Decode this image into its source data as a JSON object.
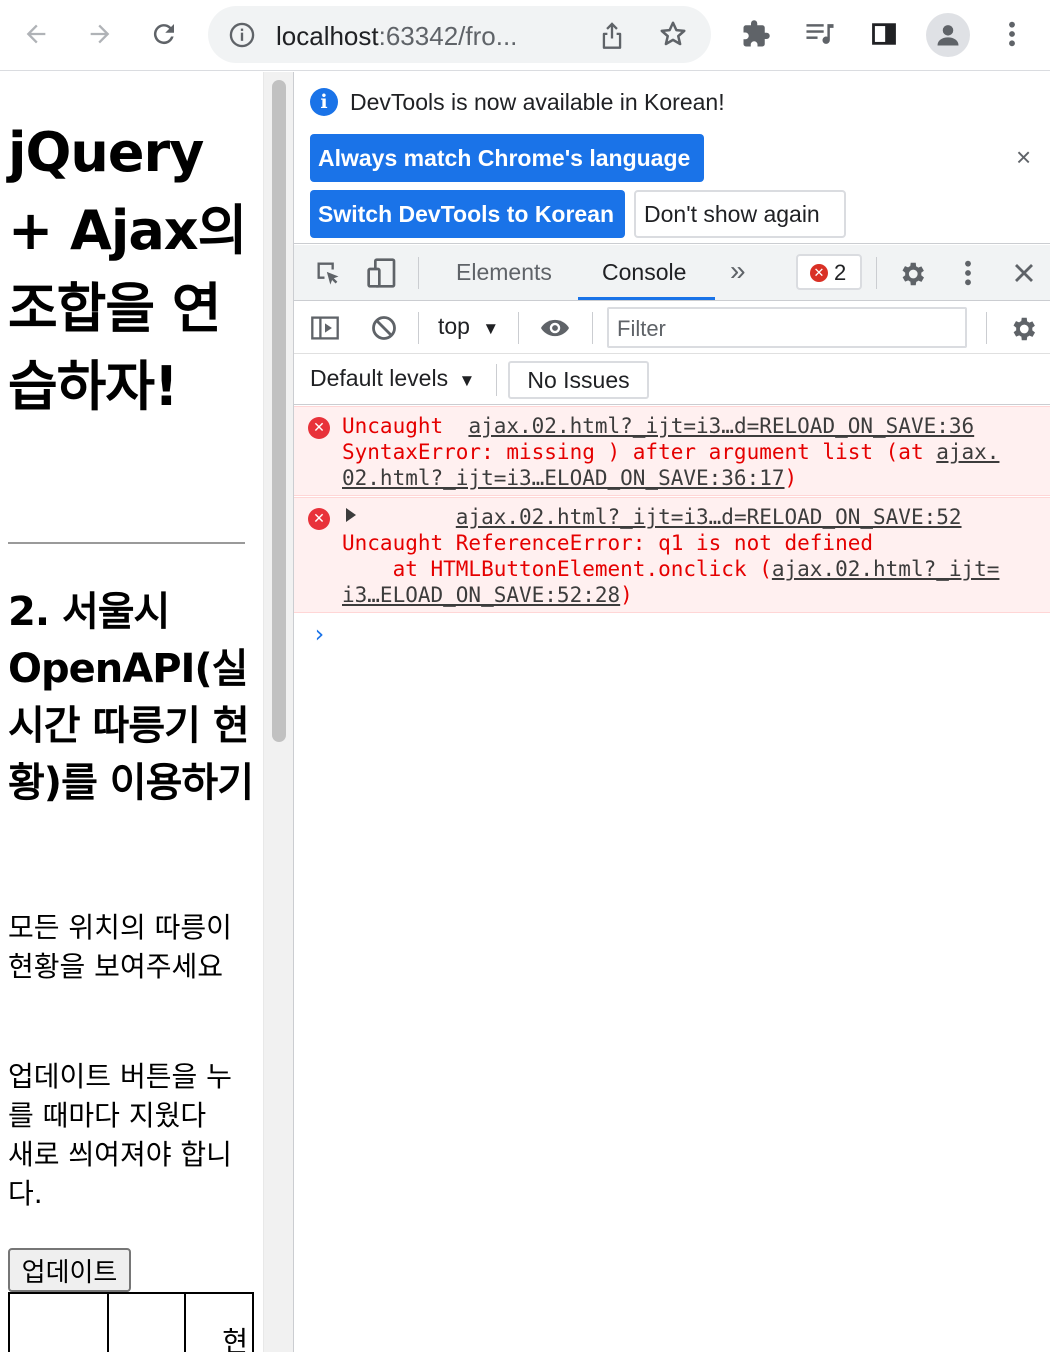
{
  "browser": {
    "url_host": "localhost",
    "url_rest": ":63342/fro..."
  },
  "page": {
    "title": "jQuery + Ajax의 조합을 연습하자!",
    "subtitle": "2. 서울시 OpenAPI(실시간 따릉기 현황)를 이용하기",
    "para1": "모든 위치의 따릉이 현황을 보여주세요",
    "para2": "업데이트 버튼을 누를 때마다 지웠다 새로 씌여져야 합니다.",
    "update_button": "업데이트",
    "table_partial_header": "현"
  },
  "devtools": {
    "infobar": {
      "message": "DevTools is now available in Korean!",
      "match_button": "Always match Chrome's language",
      "switch_button": "Switch DevTools to Korean",
      "dont_show_button": "Don't show again",
      "close": "×"
    },
    "tabs": {
      "elements": "Elements",
      "console": "Console",
      "more": "»"
    },
    "error_count": "2",
    "console_toolbar": {
      "context": "top",
      "filter_placeholder": "Filter",
      "levels": "Default levels",
      "issues": "No Issues"
    },
    "messages": [
      {
        "prefix": "Uncaught  ",
        "link": "ajax.02.html?_ijt=i3…d=RELOAD_ON_SAVE:36",
        "text": "\nSyntaxError: missing ) after argument list (at ",
        "link2": "ajax.02.html?_ijt=i3…ELOAD_ON_SAVE:36:17",
        "suffix": ")"
      },
      {
        "prefix": "         ",
        "link": "ajax.02.html?_ijt=i3…d=RELOAD_ON_SAVE:52",
        "text": "\nUncaught ReferenceError: q1 is not defined\n    at HTMLButtonElement.onclick (",
        "link2": "ajax.02.html?_ijt=i3…ELOAD_ON_SAVE:52:28",
        "suffix": ")"
      }
    ],
    "prompt": "›"
  },
  "colors": {
    "accent": "#1a73e8",
    "error_text": "#e50000",
    "error_bg": "#fff0f0"
  }
}
